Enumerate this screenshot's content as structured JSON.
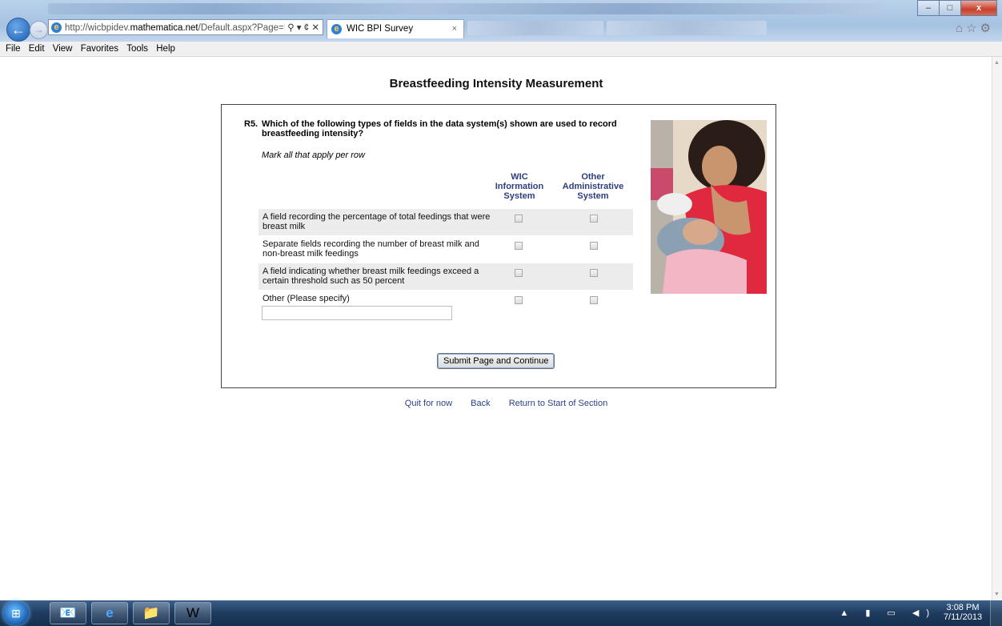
{
  "browser": {
    "url_prefix": "http://wicbpidev.",
    "url_host": "mathematica.net",
    "url_suffix": "/Default.aspx?Page=!",
    "addr_controls": "⚲ ▾ ¢ ✕",
    "tab_title": "WIC BPI Survey",
    "tab_close": "×",
    "window_controls": {
      "minimize": "–",
      "maximize": "□",
      "close": "x"
    },
    "toolbar_icons": "⌂☆⚙"
  },
  "menu": [
    "File",
    "Edit",
    "View",
    "Favorites",
    "Tools",
    "Help"
  ],
  "page": {
    "title": "Breastfeeding Intensity Measurement",
    "question_number": "R5.",
    "question_text": "Which of the following types of fields in the data system(s) shown are used to record breastfeeding intensity?",
    "instruction": "Mark all that apply per row",
    "columns": [
      "WIC Information System",
      "Other Administrative System"
    ],
    "rows": [
      {
        "label": "A field recording the percentage of total feedings that were breast milk",
        "checked": [
          false,
          false
        ]
      },
      {
        "label": "Separate fields recording the number of breast milk and non-breast milk feedings",
        "checked": [
          false,
          false
        ]
      },
      {
        "label": "A field indicating whether breast milk feedings exceed a certain threshold such as 50 percent",
        "checked": [
          false,
          false
        ]
      },
      {
        "label": "Other  (Please specify)",
        "checked": [
          false,
          false
        ]
      }
    ],
    "other_value": "",
    "submit_label": "Submit Page and Continue",
    "links": [
      "Quit for now",
      "Back",
      "Return to Start of Section"
    ]
  },
  "taskbar": {
    "time": "3:08 PM",
    "date": "7/11/2013"
  },
  "colors": {
    "column_header": "#2c3e80",
    "link": "#2a3f8c",
    "row_shade": "#ececec"
  }
}
